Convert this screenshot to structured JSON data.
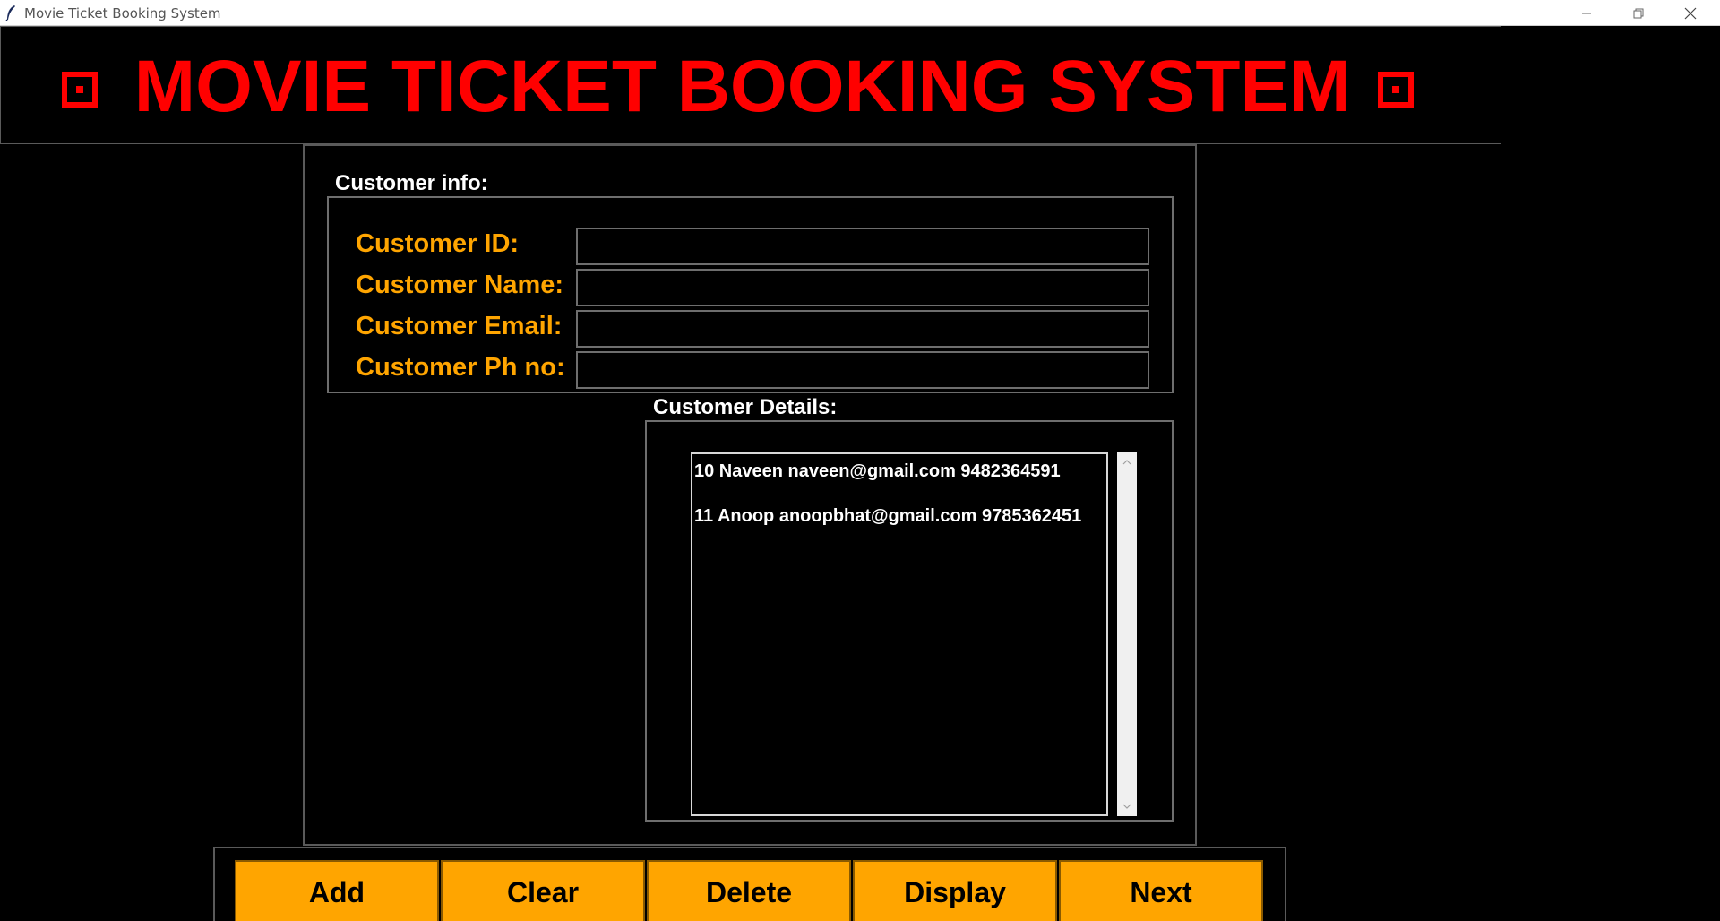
{
  "window": {
    "title": "Movie Ticket Booking System",
    "app_icon": "feather-icon",
    "controls": [
      "minimize-icon",
      "restore-icon",
      "close-icon"
    ]
  },
  "header": {
    "title": "MOVIE TICKET BOOKING SYSTEM",
    "title_color": "#ff0000",
    "icon": "box-icon"
  },
  "customer_info": {
    "legend": "Customer info:",
    "fields": [
      {
        "label": "Customer ID:",
        "value": ""
      },
      {
        "label": "Customer Name:",
        "value": ""
      },
      {
        "label": "Customer Email:",
        "value": ""
      },
      {
        "label": "Customer Ph no:",
        "value": ""
      }
    ],
    "label_color": "#ffa500"
  },
  "customer_details": {
    "legend": "Customer Details:",
    "items": [
      "10 Naveen naveen@gmail.com 9482364591",
      "11 Anoop anoopbhat@gmail.com 9785362451"
    ]
  },
  "buttons": [
    {
      "label": "Add"
    },
    {
      "label": "Clear"
    },
    {
      "label": "Delete"
    },
    {
      "label": "Display"
    },
    {
      "label": "Next"
    }
  ],
  "colors": {
    "background": "#000000",
    "button": "#ffa500",
    "accent": "#ff0000"
  }
}
